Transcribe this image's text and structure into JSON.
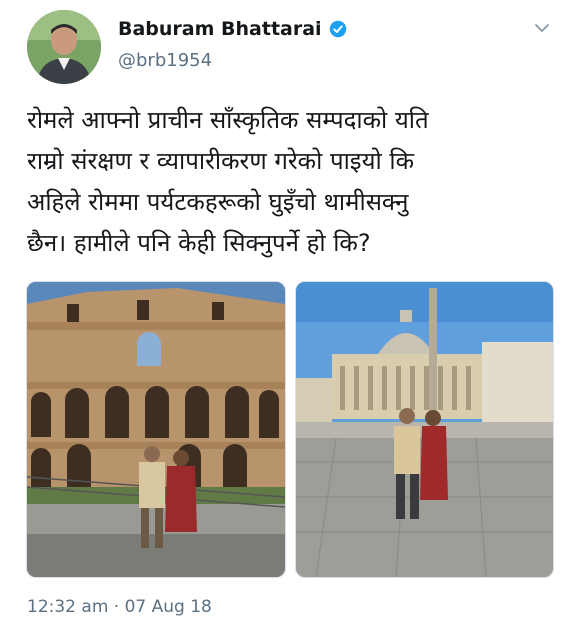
{
  "tweet": {
    "display_name": "Baburam Bhattarai",
    "handle": "@brb1954",
    "text": "रोमले आफ्नो प्राचीन साँस्कृतिक सम्पदाको यति\nराम्रो संरक्षण र व्यापारीकरण गरेको पाइयो कि\nअहिले रोममा पर्यटकहरूको घुइँचो थामीसक्नु\nछैन। हामीले पनि केही सिक्नुपर्ने हो कि?",
    "time": "12:32 am",
    "separator": "·",
    "date": "07 Aug 18",
    "verified": true,
    "icons": {
      "verified": "verified-badge-icon",
      "more": "chevron-down-icon"
    },
    "colors": {
      "verified_blue": "#1da1f2",
      "secondary_text": "#5b7083"
    },
    "photos": [
      {
        "subject": "colosseum-photo"
      },
      {
        "subject": "st-peters-square-photo"
      }
    ]
  }
}
